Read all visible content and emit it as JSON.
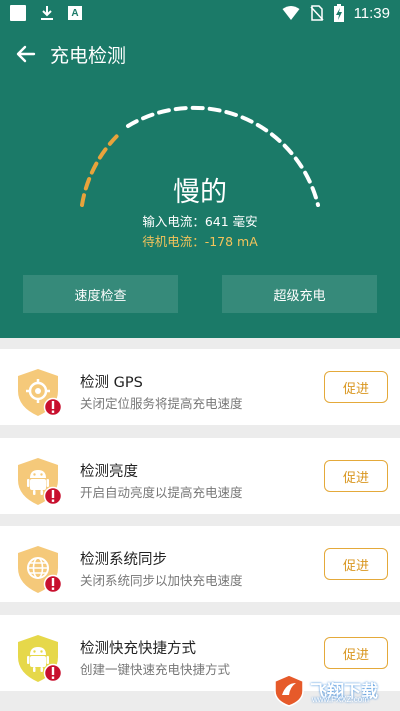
{
  "status_bar": {
    "time": "11:39",
    "icons": [
      "notification-square-icon",
      "download-icon",
      "font-a-icon",
      "wifi-icon",
      "no-sim-icon",
      "battery-charging-icon"
    ]
  },
  "header": {
    "title": "充电检测",
    "back_icon": "arrow-left-icon"
  },
  "gauge": {
    "speed_label": "慢的",
    "input_current": "输入电流：641 毫安",
    "standby_current": "待机电流：-178 mA",
    "colors": {
      "active": "#e8a33b",
      "inactive": "#ffffff"
    }
  },
  "actions": {
    "speed_check": "速度检查",
    "super_charge": "超级充电"
  },
  "checks": [
    {
      "title": "检测 GPS",
      "desc": "关闭定位服务将提高充电速度",
      "button": "促进",
      "icon": "gps-target-icon",
      "shield_color": "#f5c97a"
    },
    {
      "title": "检测亮度",
      "desc": "开启自动亮度以提高充电速度",
      "button": "促进",
      "icon": "android-icon",
      "shield_color": "#f5c97a"
    },
    {
      "title": "检测系统同步",
      "desc": "关闭系统同步以加快充电速度",
      "button": "促进",
      "icon": "globe-icon",
      "shield_color": "#f5c97a"
    },
    {
      "title": "检测快充快捷方式",
      "desc": "创建一键快速充电快捷方式",
      "button": "促进",
      "icon": "android-icon",
      "shield_color": "#e6d84a"
    }
  ],
  "watermark": {
    "text": "飞翔下载",
    "url": "www.FXXZ.com"
  },
  "colors": {
    "primary": "#1b7a68",
    "accent": "#e4a93a",
    "alert": "#c8102e"
  }
}
